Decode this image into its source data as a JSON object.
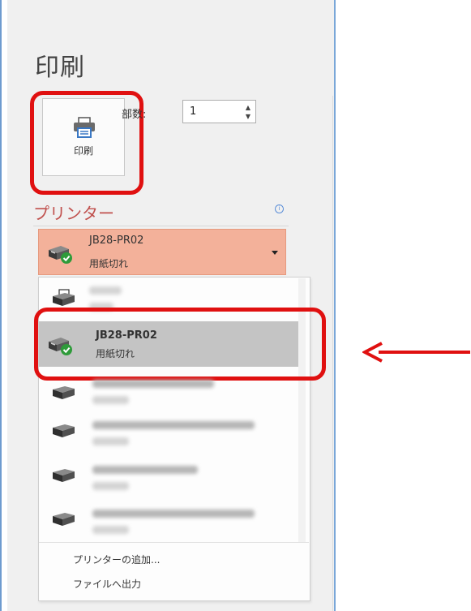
{
  "page": {
    "title": "印刷"
  },
  "print_button": {
    "label": "印刷",
    "icon": "printer-icon"
  },
  "copies": {
    "label": "部数:",
    "value": "1"
  },
  "printer_section": {
    "header": "プリンター",
    "info_icon": "info-icon"
  },
  "selected_printer": {
    "name": "JB28-PR02",
    "status": "用紙切れ",
    "icon": "printer-ok-icon"
  },
  "printer_list": [
    {
      "name": "",
      "status": "",
      "blurred": true
    },
    {
      "name": "JB28-PR02",
      "status": "用紙切れ",
      "selected": true
    },
    {
      "name": "",
      "status": "",
      "blurred": true
    },
    {
      "name": "",
      "status": "",
      "blurred": true
    },
    {
      "name": "",
      "status": "",
      "blurred": true
    },
    {
      "name": "",
      "status": "",
      "blurred": true
    }
  ],
  "list_footer": {
    "add_printer": "プリンターの追加...",
    "print_to_file": "ファイルへ出力"
  },
  "colors": {
    "accent_red": "#e01010",
    "selected_orange": "#f3b19a",
    "header_red": "#c0504d",
    "check_green": "#2e9b3a"
  }
}
